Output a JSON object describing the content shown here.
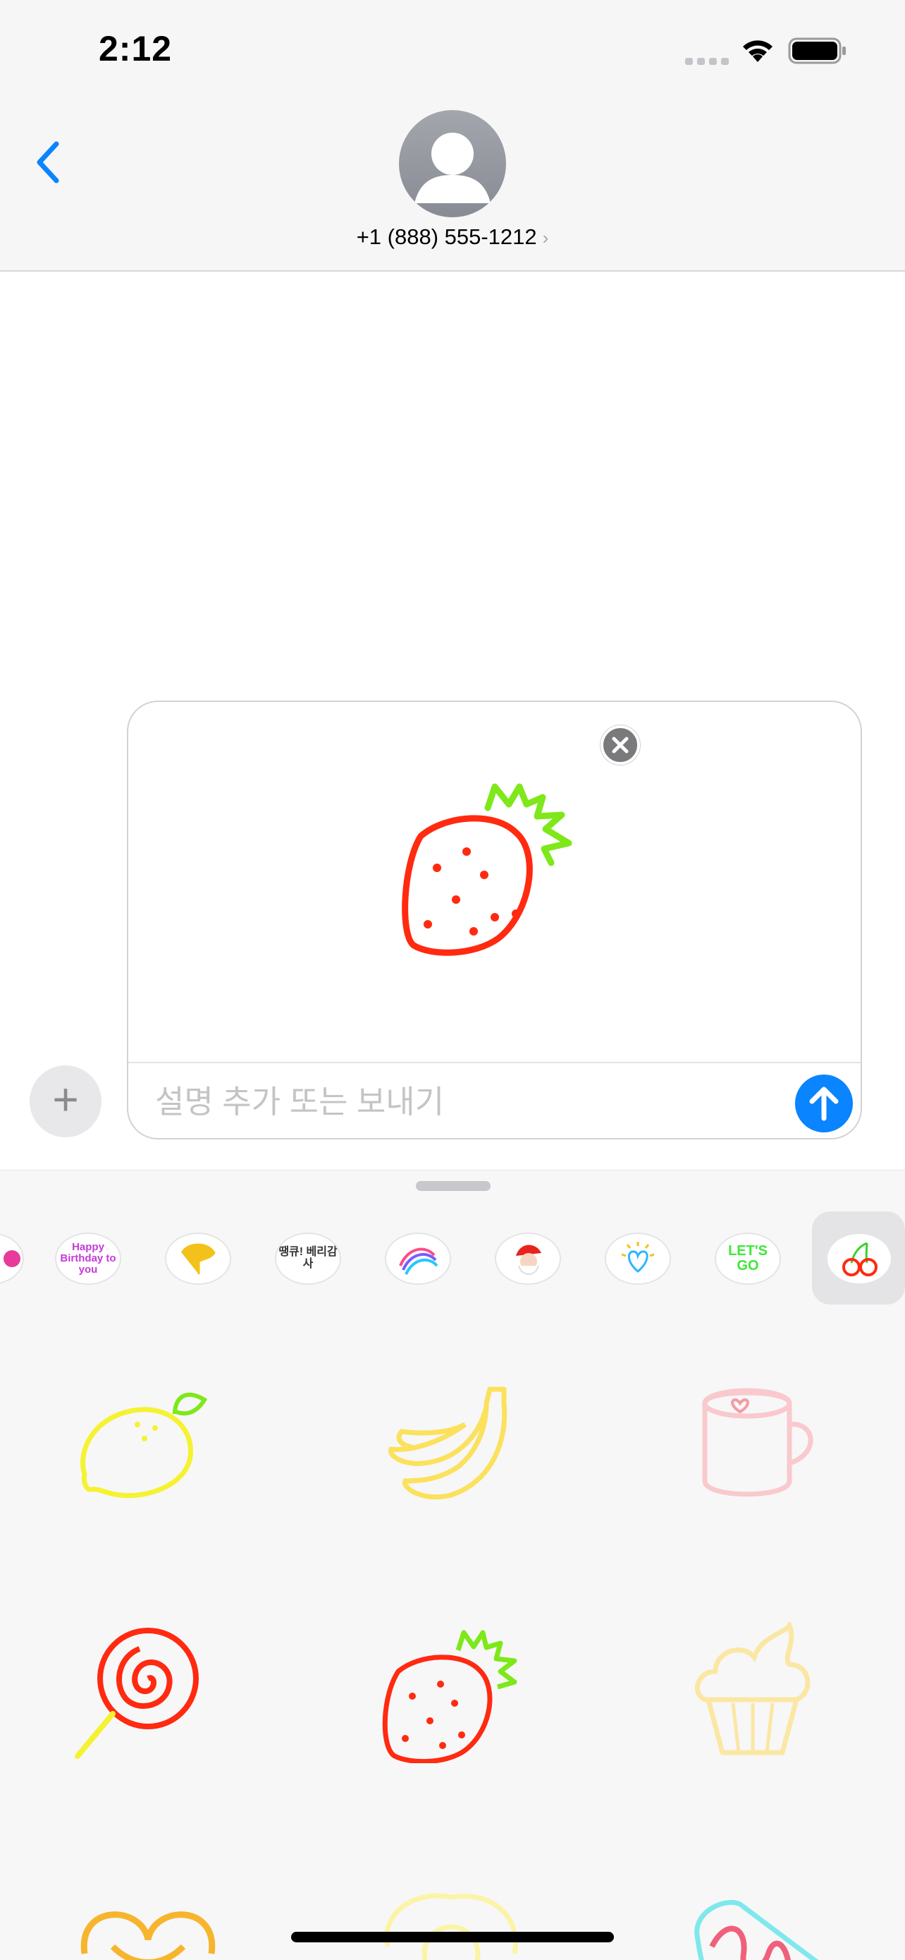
{
  "status_bar": {
    "time": "2:12",
    "wifi_icon": "wifi-icon",
    "battery_icon": "battery-icon"
  },
  "header": {
    "back_icon": "chevron-left-icon",
    "contact_number": "+1 (888) 555-1212",
    "contact_chevron": "›",
    "avatar_icon": "person-icon"
  },
  "compose": {
    "placeholder": "설명 추가 또는 보내기",
    "attached_sticker": "strawberry",
    "remove_icon": "close-icon",
    "send_icon": "arrow-up-icon",
    "add_label": "+"
  },
  "sticker_packs": [
    {
      "id": "partial"
    },
    {
      "id": "happy-birthday",
      "text": "Happy Birthday to you"
    },
    {
      "id": "ginkgo-leaf"
    },
    {
      "id": "thanks-korean",
      "text": "땡큐! 베리감사"
    },
    {
      "id": "rainbow-heart"
    },
    {
      "id": "santa"
    },
    {
      "id": "sparkle-heart"
    },
    {
      "id": "lets-go",
      "text": "LET'S GO"
    },
    {
      "id": "cherry",
      "selected": true
    }
  ],
  "stickers": [
    "lemon",
    "banana",
    "mug",
    "lollipop",
    "strawberry",
    "cupcake",
    "pretzel",
    "egg",
    "popsicle"
  ],
  "colors": {
    "accent": "#0a84ff",
    "strawberry_red": "#ff2a10",
    "leaf_green": "#7ee81a"
  }
}
